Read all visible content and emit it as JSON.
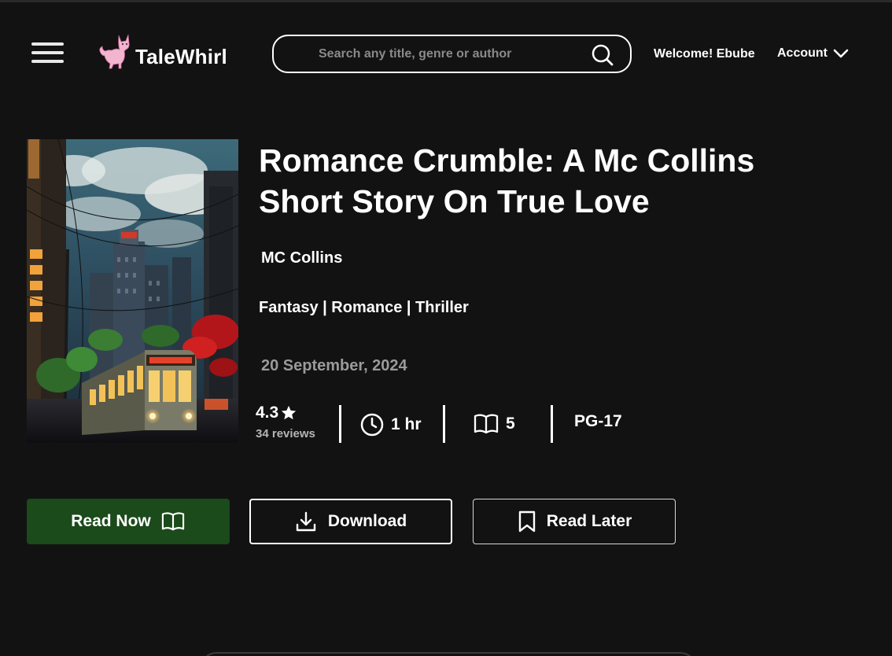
{
  "header": {
    "brand": "TaleWhirl",
    "search_placeholder": "Search any title, genre or author",
    "welcome": "Welcome! Ebube",
    "account_label": "Account"
  },
  "book": {
    "title": "Romance Crumble: A Mc Collins Short Story On True Love",
    "author": "MC Collins",
    "genres": "Fantasy | Romance | Thriller",
    "date": "20 September, 2024",
    "rating": "4.3",
    "reviews": "34 reviews",
    "duration": "1 hr",
    "chapters": "5",
    "age_rating": "PG-17"
  },
  "actions": {
    "read_now": "Read Now",
    "download": "Download",
    "read_later": "Read Later"
  },
  "colors": {
    "background": "#121212",
    "read_now_bg": "#1b4a1b",
    "logo_accent": "#f2b5cf"
  }
}
